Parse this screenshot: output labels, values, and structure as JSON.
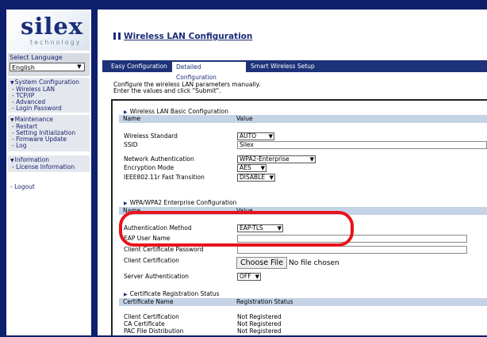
{
  "brand": {
    "name": "silex",
    "tagline": "technology"
  },
  "language": {
    "label": "Select Language",
    "selected": "English"
  },
  "menu": {
    "groups": [
      {
        "title": "System Configuration",
        "items": [
          "Wireless LAN",
          "TCP/IP",
          "Advanced",
          "Login Password"
        ]
      },
      {
        "title": "Maintenance",
        "items": [
          "Restart",
          "Setting Initialization",
          "Firmware Update",
          "Log"
        ]
      },
      {
        "title": "Information",
        "items": [
          "License Information"
        ]
      }
    ],
    "logout": "Logout"
  },
  "page": {
    "title": "Wireless LAN Configuration",
    "tabs": [
      "Easy Configuration",
      "Detailed Configuration",
      "Smart Wireless Setup"
    ],
    "active_tab": "Detailed Configuration",
    "intro_line1": "Configure the wireless LAN parameters manually.",
    "intro_line2": "Enter the values and click \"Submit\"."
  },
  "basic": {
    "title": "Wireless LAN Basic Configuration",
    "col_name": "Name",
    "col_value": "Value",
    "wireless_standard": {
      "label": "Wireless Standard",
      "value": "AUTO"
    },
    "ssid": {
      "label": "SSID",
      "value": "Silex"
    },
    "network_auth": {
      "label": "Network Authentication",
      "value": "WPA2-Enterprise"
    },
    "encryption": {
      "label": "Encryption Mode",
      "value": "AES"
    },
    "fast_transition": {
      "label": "IEEE802.11r Fast Transition",
      "value": "DISABLE"
    }
  },
  "enterprise": {
    "title": "WPA/WPA2 Enterprise Configuration",
    "col_name": "Name",
    "col_value": "Value",
    "auth_method": {
      "label": "Authentication Method",
      "value": "EAP-TLS"
    },
    "eap_user": {
      "label": "EAP User Name",
      "value": ""
    },
    "cert_password": {
      "label": "Client Certificate Password",
      "value": ""
    },
    "client_cert": {
      "label": "Client Certification",
      "button": "Choose File",
      "status": "No file chosen"
    },
    "server_auth": {
      "label": "Server Authentication",
      "value": "OFF"
    }
  },
  "cert_status": {
    "title": "Certificate Registration Status",
    "col_name": "Certificate Name",
    "col_status": "Registration Status",
    "rows": [
      {
        "name": "Client Certification",
        "status": "Not Registered"
      },
      {
        "name": "CA Certificate",
        "status": "Not Registered"
      },
      {
        "name": "PAC File Distribution",
        "status": "Not Registered"
      }
    ]
  },
  "colors": {
    "frame_bg": "#0e1f6e",
    "tab_bar": "#1d3279",
    "table_header": "#c5d3e6",
    "highlight": "#e8131d"
  }
}
